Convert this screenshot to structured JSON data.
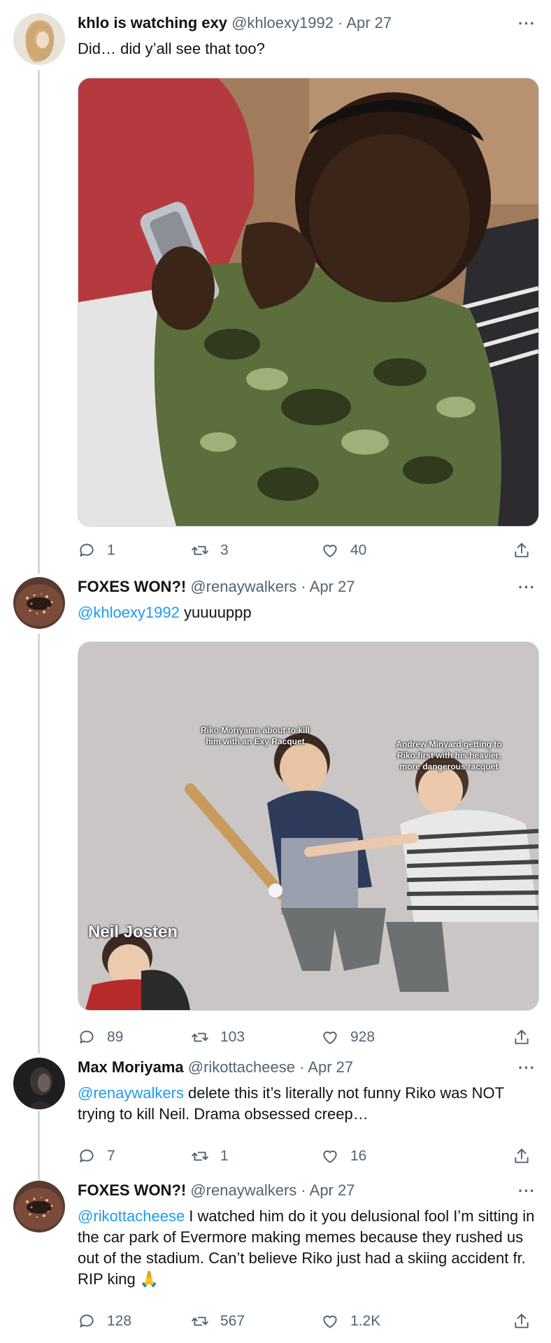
{
  "tweets": [
    {
      "display_name": "khlo is watching exy",
      "handle": "@khloexy1992",
      "date": "Apr 27",
      "text": "Did… did y’all see that too?",
      "replies": "1",
      "retweets": "3",
      "likes": "40",
      "avatar_color": "#d9c6a3",
      "media_description": "Child covering mouth while looking at phone"
    },
    {
      "display_name": "FOXES WON?!",
      "handle": "@renaywalkers",
      "date": "Apr 27",
      "mention": "@khloexy1992",
      "text": " yuuuuppp",
      "replies": "89",
      "retweets": "103",
      "likes": "928",
      "avatar_color": "#5a3a30",
      "meme": {
        "caption_center": "Riko Moriyama about to kill him with an Exy Racquet",
        "caption_right": "Andrew Minyard getting to Riko first with his heavier, more dangerous racquet",
        "caption_left": "Neil Josten"
      }
    },
    {
      "display_name": "Max Moriyama",
      "handle": "@rikottacheese",
      "date": "Apr 27",
      "mention": "@renaywalkers",
      "text": " delete this it’s literally not funny Riko was NOT trying to kill Neil. Drama obsessed creep…",
      "replies": "7",
      "retweets": "1",
      "likes": "16",
      "avatar_color": "#2a2a2a"
    },
    {
      "display_name": "FOXES WON?!",
      "handle": "@renaywalkers",
      "date": "Apr 27",
      "mention": "@rikottacheese",
      "text": " I watched him do it you delusional fool I’m sitting in the car park of Evermore making memes because they rushed us out of the stadium. Can’t believe Riko just had a skiing accident fr. RIP king 🙏",
      "replies": "128",
      "retweets": "567",
      "likes": "1.2K",
      "avatar_color": "#5a3a30"
    }
  ],
  "ui": {
    "separator": "·",
    "more_glyph": "···",
    "accent": "#1d9bf0",
    "muted": "#536471"
  }
}
